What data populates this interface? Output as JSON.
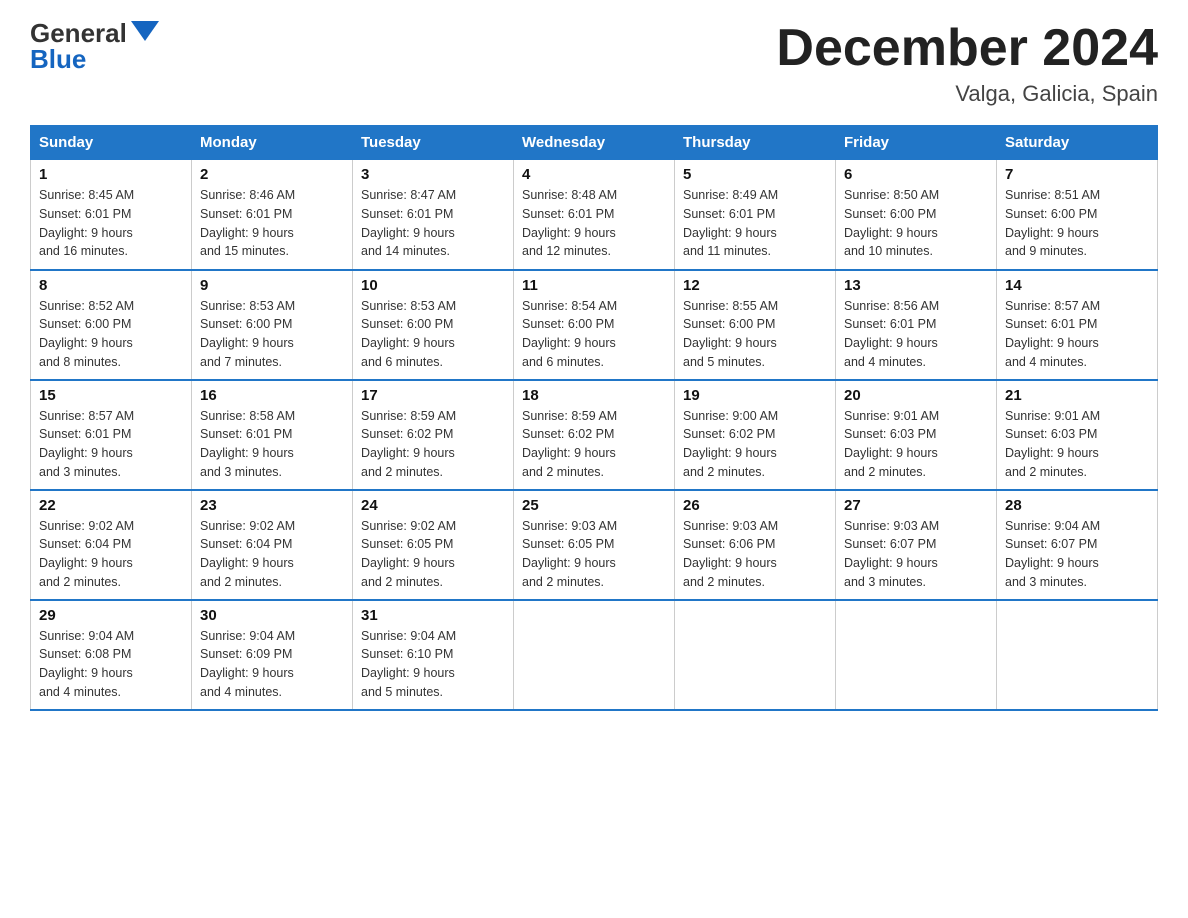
{
  "header": {
    "logo_general": "General",
    "logo_blue": "Blue",
    "month_title": "December 2024",
    "location": "Valga, Galicia, Spain"
  },
  "weekdays": [
    "Sunday",
    "Monday",
    "Tuesday",
    "Wednesday",
    "Thursday",
    "Friday",
    "Saturday"
  ],
  "weeks": [
    [
      {
        "day": "1",
        "sunrise": "8:45 AM",
        "sunset": "6:01 PM",
        "daylight": "9 hours and 16 minutes."
      },
      {
        "day": "2",
        "sunrise": "8:46 AM",
        "sunset": "6:01 PM",
        "daylight": "9 hours and 15 minutes."
      },
      {
        "day": "3",
        "sunrise": "8:47 AM",
        "sunset": "6:01 PM",
        "daylight": "9 hours and 14 minutes."
      },
      {
        "day": "4",
        "sunrise": "8:48 AM",
        "sunset": "6:01 PM",
        "daylight": "9 hours and 12 minutes."
      },
      {
        "day": "5",
        "sunrise": "8:49 AM",
        "sunset": "6:01 PM",
        "daylight": "9 hours and 11 minutes."
      },
      {
        "day": "6",
        "sunrise": "8:50 AM",
        "sunset": "6:00 PM",
        "daylight": "9 hours and 10 minutes."
      },
      {
        "day": "7",
        "sunrise": "8:51 AM",
        "sunset": "6:00 PM",
        "daylight": "9 hours and 9 minutes."
      }
    ],
    [
      {
        "day": "8",
        "sunrise": "8:52 AM",
        "sunset": "6:00 PM",
        "daylight": "9 hours and 8 minutes."
      },
      {
        "day": "9",
        "sunrise": "8:53 AM",
        "sunset": "6:00 PM",
        "daylight": "9 hours and 7 minutes."
      },
      {
        "day": "10",
        "sunrise": "8:53 AM",
        "sunset": "6:00 PM",
        "daylight": "9 hours and 6 minutes."
      },
      {
        "day": "11",
        "sunrise": "8:54 AM",
        "sunset": "6:00 PM",
        "daylight": "9 hours and 6 minutes."
      },
      {
        "day": "12",
        "sunrise": "8:55 AM",
        "sunset": "6:00 PM",
        "daylight": "9 hours and 5 minutes."
      },
      {
        "day": "13",
        "sunrise": "8:56 AM",
        "sunset": "6:01 PM",
        "daylight": "9 hours and 4 minutes."
      },
      {
        "day": "14",
        "sunrise": "8:57 AM",
        "sunset": "6:01 PM",
        "daylight": "9 hours and 4 minutes."
      }
    ],
    [
      {
        "day": "15",
        "sunrise": "8:57 AM",
        "sunset": "6:01 PM",
        "daylight": "9 hours and 3 minutes."
      },
      {
        "day": "16",
        "sunrise": "8:58 AM",
        "sunset": "6:01 PM",
        "daylight": "9 hours and 3 minutes."
      },
      {
        "day": "17",
        "sunrise": "8:59 AM",
        "sunset": "6:02 PM",
        "daylight": "9 hours and 2 minutes."
      },
      {
        "day": "18",
        "sunrise": "8:59 AM",
        "sunset": "6:02 PM",
        "daylight": "9 hours and 2 minutes."
      },
      {
        "day": "19",
        "sunrise": "9:00 AM",
        "sunset": "6:02 PM",
        "daylight": "9 hours and 2 minutes."
      },
      {
        "day": "20",
        "sunrise": "9:01 AM",
        "sunset": "6:03 PM",
        "daylight": "9 hours and 2 minutes."
      },
      {
        "day": "21",
        "sunrise": "9:01 AM",
        "sunset": "6:03 PM",
        "daylight": "9 hours and 2 minutes."
      }
    ],
    [
      {
        "day": "22",
        "sunrise": "9:02 AM",
        "sunset": "6:04 PM",
        "daylight": "9 hours and 2 minutes."
      },
      {
        "day": "23",
        "sunrise": "9:02 AM",
        "sunset": "6:04 PM",
        "daylight": "9 hours and 2 minutes."
      },
      {
        "day": "24",
        "sunrise": "9:02 AM",
        "sunset": "6:05 PM",
        "daylight": "9 hours and 2 minutes."
      },
      {
        "day": "25",
        "sunrise": "9:03 AM",
        "sunset": "6:05 PM",
        "daylight": "9 hours and 2 minutes."
      },
      {
        "day": "26",
        "sunrise": "9:03 AM",
        "sunset": "6:06 PM",
        "daylight": "9 hours and 2 minutes."
      },
      {
        "day": "27",
        "sunrise": "9:03 AM",
        "sunset": "6:07 PM",
        "daylight": "9 hours and 3 minutes."
      },
      {
        "day": "28",
        "sunrise": "9:04 AM",
        "sunset": "6:07 PM",
        "daylight": "9 hours and 3 minutes."
      }
    ],
    [
      {
        "day": "29",
        "sunrise": "9:04 AM",
        "sunset": "6:08 PM",
        "daylight": "9 hours and 4 minutes."
      },
      {
        "day": "30",
        "sunrise": "9:04 AM",
        "sunset": "6:09 PM",
        "daylight": "9 hours and 4 minutes."
      },
      {
        "day": "31",
        "sunrise": "9:04 AM",
        "sunset": "6:10 PM",
        "daylight": "9 hours and 5 minutes."
      },
      null,
      null,
      null,
      null
    ]
  ],
  "labels": {
    "sunrise": "Sunrise:",
    "sunset": "Sunset:",
    "daylight": "Daylight:"
  }
}
